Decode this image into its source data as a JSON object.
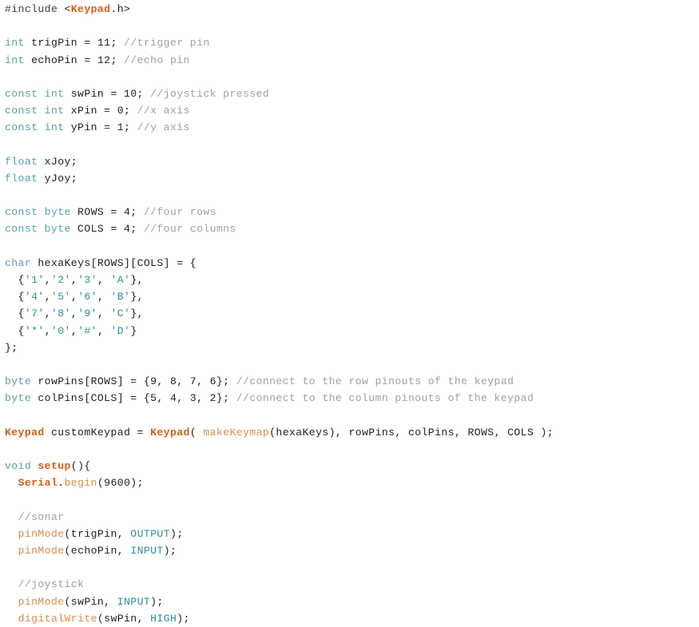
{
  "editor": {
    "name": "arduino-code-editor",
    "language": "arduino-cpp",
    "background": "#ffffff",
    "colors": {
      "plain": "#1d1d1d",
      "keyword": "#5c9fa8",
      "keyword2": "#d35f12",
      "function": "#d98c4a",
      "literal": "#2e8f8f",
      "comment": "#a0a0a0",
      "preprocessor": "#3b3b3b"
    }
  },
  "code": {
    "lines": [
      {
        "n": 1,
        "tokens": [
          {
            "t": "#include ",
            "c": "preproc"
          },
          {
            "t": "<",
            "c": "plain"
          },
          {
            "t": "Keypad",
            "c": "keyword2"
          },
          {
            "t": ".h>",
            "c": "plain"
          }
        ]
      },
      {
        "n": 2,
        "tokens": []
      },
      {
        "n": 3,
        "tokens": [
          {
            "t": "int",
            "c": "keyword"
          },
          {
            "t": " trigPin = 11; ",
            "c": "plain"
          },
          {
            "t": "//trigger pin",
            "c": "comment"
          }
        ]
      },
      {
        "n": 4,
        "tokens": [
          {
            "t": "int",
            "c": "keyword"
          },
          {
            "t": " echoPin = 12; ",
            "c": "plain"
          },
          {
            "t": "//echo pin",
            "c": "comment"
          }
        ]
      },
      {
        "n": 5,
        "tokens": []
      },
      {
        "n": 6,
        "tokens": [
          {
            "t": "const int",
            "c": "keyword"
          },
          {
            "t": " swPin = 10; ",
            "c": "plain"
          },
          {
            "t": "//joystick pressed",
            "c": "comment"
          }
        ]
      },
      {
        "n": 7,
        "tokens": [
          {
            "t": "const int",
            "c": "keyword"
          },
          {
            "t": " xPin = 0; ",
            "c": "plain"
          },
          {
            "t": "//x axis",
            "c": "comment"
          }
        ]
      },
      {
        "n": 8,
        "tokens": [
          {
            "t": "const int",
            "c": "keyword"
          },
          {
            "t": " yPin = 1; ",
            "c": "plain"
          },
          {
            "t": "//y axis",
            "c": "comment"
          }
        ]
      },
      {
        "n": 9,
        "tokens": []
      },
      {
        "n": 10,
        "tokens": [
          {
            "t": "float",
            "c": "keyword"
          },
          {
            "t": " xJoy;",
            "c": "plain"
          }
        ]
      },
      {
        "n": 11,
        "tokens": [
          {
            "t": "float",
            "c": "keyword"
          },
          {
            "t": " yJoy;",
            "c": "plain"
          }
        ]
      },
      {
        "n": 12,
        "tokens": []
      },
      {
        "n": 13,
        "tokens": [
          {
            "t": "const byte",
            "c": "keyword"
          },
          {
            "t": " ROWS = 4; ",
            "c": "plain"
          },
          {
            "t": "//four rows",
            "c": "comment"
          }
        ]
      },
      {
        "n": 14,
        "tokens": [
          {
            "t": "const byte",
            "c": "keyword"
          },
          {
            "t": " COLS = 4; ",
            "c": "plain"
          },
          {
            "t": "//four columns",
            "c": "comment"
          }
        ]
      },
      {
        "n": 15,
        "tokens": []
      },
      {
        "n": 16,
        "tokens": [
          {
            "t": "char",
            "c": "keyword"
          },
          {
            "t": " hexaKeys[ROWS][COLS] = {",
            "c": "plain"
          }
        ]
      },
      {
        "n": 17,
        "tokens": [
          {
            "t": "  {",
            "c": "plain"
          },
          {
            "t": "'1'",
            "c": "literal"
          },
          {
            "t": ",",
            "c": "plain"
          },
          {
            "t": "'2'",
            "c": "literal"
          },
          {
            "t": ",",
            "c": "plain"
          },
          {
            "t": "'3'",
            "c": "literal"
          },
          {
            "t": ", ",
            "c": "plain"
          },
          {
            "t": "'A'",
            "c": "literal"
          },
          {
            "t": "},",
            "c": "plain"
          }
        ]
      },
      {
        "n": 18,
        "tokens": [
          {
            "t": "  {",
            "c": "plain"
          },
          {
            "t": "'4'",
            "c": "literal"
          },
          {
            "t": ",",
            "c": "plain"
          },
          {
            "t": "'5'",
            "c": "literal"
          },
          {
            "t": ",",
            "c": "plain"
          },
          {
            "t": "'6'",
            "c": "literal"
          },
          {
            "t": ", ",
            "c": "plain"
          },
          {
            "t": "'B'",
            "c": "literal"
          },
          {
            "t": "},",
            "c": "plain"
          }
        ]
      },
      {
        "n": 19,
        "tokens": [
          {
            "t": "  {",
            "c": "plain"
          },
          {
            "t": "'7'",
            "c": "literal"
          },
          {
            "t": ",",
            "c": "plain"
          },
          {
            "t": "'8'",
            "c": "literal"
          },
          {
            "t": ",",
            "c": "plain"
          },
          {
            "t": "'9'",
            "c": "literal"
          },
          {
            "t": ", ",
            "c": "plain"
          },
          {
            "t": "'C'",
            "c": "literal"
          },
          {
            "t": "},",
            "c": "plain"
          }
        ]
      },
      {
        "n": 20,
        "tokens": [
          {
            "t": "  {",
            "c": "plain"
          },
          {
            "t": "'*'",
            "c": "literal"
          },
          {
            "t": ",",
            "c": "plain"
          },
          {
            "t": "'0'",
            "c": "literal"
          },
          {
            "t": ",",
            "c": "plain"
          },
          {
            "t": "'#'",
            "c": "literal"
          },
          {
            "t": ", ",
            "c": "plain"
          },
          {
            "t": "'D'",
            "c": "literal"
          },
          {
            "t": "}",
            "c": "plain"
          }
        ]
      },
      {
        "n": 21,
        "tokens": [
          {
            "t": "};",
            "c": "plain"
          }
        ]
      },
      {
        "n": 22,
        "tokens": []
      },
      {
        "n": 23,
        "tokens": [
          {
            "t": "byte",
            "c": "keyword"
          },
          {
            "t": " rowPins[ROWS] = {9, 8, 7, 6}; ",
            "c": "plain"
          },
          {
            "t": "//connect to the row pinouts of the keypad",
            "c": "comment"
          }
        ]
      },
      {
        "n": 24,
        "tokens": [
          {
            "t": "byte",
            "c": "keyword"
          },
          {
            "t": " colPins[COLS] = {5, 4, 3, 2}; ",
            "c": "plain"
          },
          {
            "t": "//connect to the column pinouts of the keypad",
            "c": "comment"
          }
        ]
      },
      {
        "n": 25,
        "tokens": []
      },
      {
        "n": 26,
        "tokens": [
          {
            "t": "Keypad",
            "c": "keyword2"
          },
          {
            "t": " customKeypad = ",
            "c": "plain"
          },
          {
            "t": "Keypad",
            "c": "keyword2"
          },
          {
            "t": "( ",
            "c": "plain"
          },
          {
            "t": "makeKeymap",
            "c": "func"
          },
          {
            "t": "(hexaKeys), rowPins, colPins, ROWS, COLS );",
            "c": "plain"
          }
        ]
      },
      {
        "n": 27,
        "tokens": []
      },
      {
        "n": 28,
        "tokens": [
          {
            "t": "void",
            "c": "keyword"
          },
          {
            "t": " ",
            "c": "plain"
          },
          {
            "t": "setup",
            "c": "keyword2"
          },
          {
            "t": "(){",
            "c": "plain"
          }
        ]
      },
      {
        "n": 29,
        "tokens": [
          {
            "t": "  ",
            "c": "plain"
          },
          {
            "t": "Serial",
            "c": "keyword2"
          },
          {
            "t": ".",
            "c": "plain"
          },
          {
            "t": "begin",
            "c": "func"
          },
          {
            "t": "(9600);",
            "c": "plain"
          }
        ]
      },
      {
        "n": 30,
        "tokens": []
      },
      {
        "n": 31,
        "tokens": [
          {
            "t": "  ",
            "c": "plain"
          },
          {
            "t": "//sonar",
            "c": "comment"
          }
        ]
      },
      {
        "n": 32,
        "tokens": [
          {
            "t": "  ",
            "c": "plain"
          },
          {
            "t": "pinMode",
            "c": "func"
          },
          {
            "t": "(trigPin, ",
            "c": "plain"
          },
          {
            "t": "OUTPUT",
            "c": "literal"
          },
          {
            "t": ");",
            "c": "plain"
          }
        ]
      },
      {
        "n": 33,
        "tokens": [
          {
            "t": "  ",
            "c": "plain"
          },
          {
            "t": "pinMode",
            "c": "func"
          },
          {
            "t": "(echoPin, ",
            "c": "plain"
          },
          {
            "t": "INPUT",
            "c": "literal"
          },
          {
            "t": ");",
            "c": "plain"
          }
        ]
      },
      {
        "n": 34,
        "tokens": []
      },
      {
        "n": 35,
        "tokens": [
          {
            "t": "  ",
            "c": "plain"
          },
          {
            "t": "//joystick",
            "c": "comment"
          }
        ]
      },
      {
        "n": 36,
        "tokens": [
          {
            "t": "  ",
            "c": "plain"
          },
          {
            "t": "pinMode",
            "c": "func"
          },
          {
            "t": "(swPin, ",
            "c": "plain"
          },
          {
            "t": "INPUT",
            "c": "literal"
          },
          {
            "t": ");",
            "c": "plain"
          }
        ]
      },
      {
        "n": 37,
        "tokens": [
          {
            "t": "  ",
            "c": "plain"
          },
          {
            "t": "digitalWrite",
            "c": "func"
          },
          {
            "t": "(swPin, ",
            "c": "plain"
          },
          {
            "t": "HIGH",
            "c": "literal"
          },
          {
            "t": ");",
            "c": "plain"
          }
        ]
      }
    ]
  }
}
